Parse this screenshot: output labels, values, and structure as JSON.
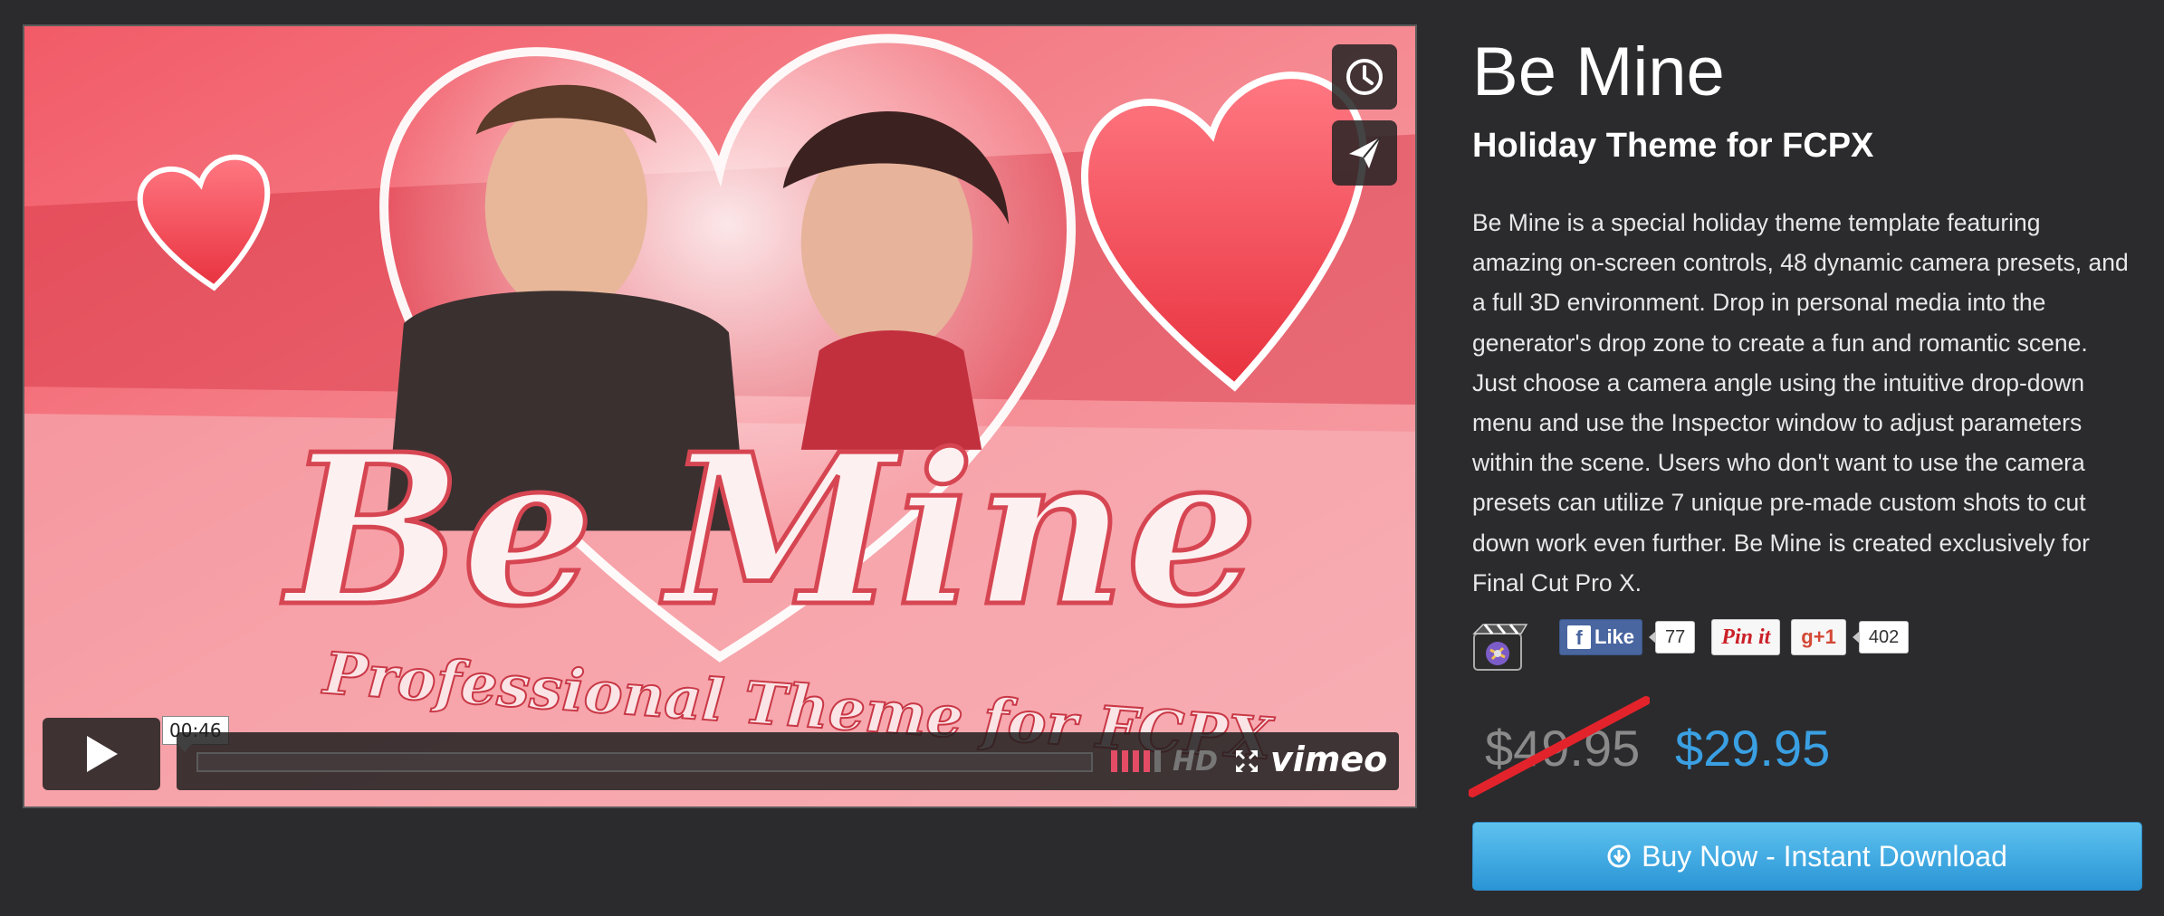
{
  "video": {
    "timecode": "00:46",
    "hd_label": "HD",
    "brand": "vimeo",
    "poster_title": "Be Mine",
    "poster_tagline": "Professional Theme for FCPX",
    "volume": 0.8
  },
  "product": {
    "title": "Be Mine",
    "subtitle": "Holiday Theme for FCPX",
    "description": "Be Mine is a special holiday theme template featuring amazing on-screen controls, 48 dynamic camera presets, and a full 3D environment. Drop in personal media into the generator's drop zone to create a fun and romantic scene. Just choose a camera angle using the intuitive drop-down menu and use the Inspector window to adjust parameters within the scene. Users who don't want to use the camera presets can utilize 7 unique pre-made custom shots to cut down work even further. Be Mine is created exclusively for Final Cut Pro X."
  },
  "social": {
    "fb_label": "Like",
    "fb_count": "77",
    "pin_label": "Pin it",
    "gplus_label": "+1",
    "gplus_count": "402"
  },
  "pricing": {
    "old_price": "$49.95",
    "new_price": "$29.95"
  },
  "buy": {
    "label": "Buy Now - Instant Download"
  },
  "colors": {
    "background": "#2b2b2d",
    "accent": "#3aa0e3",
    "strike": "#e3232b"
  }
}
